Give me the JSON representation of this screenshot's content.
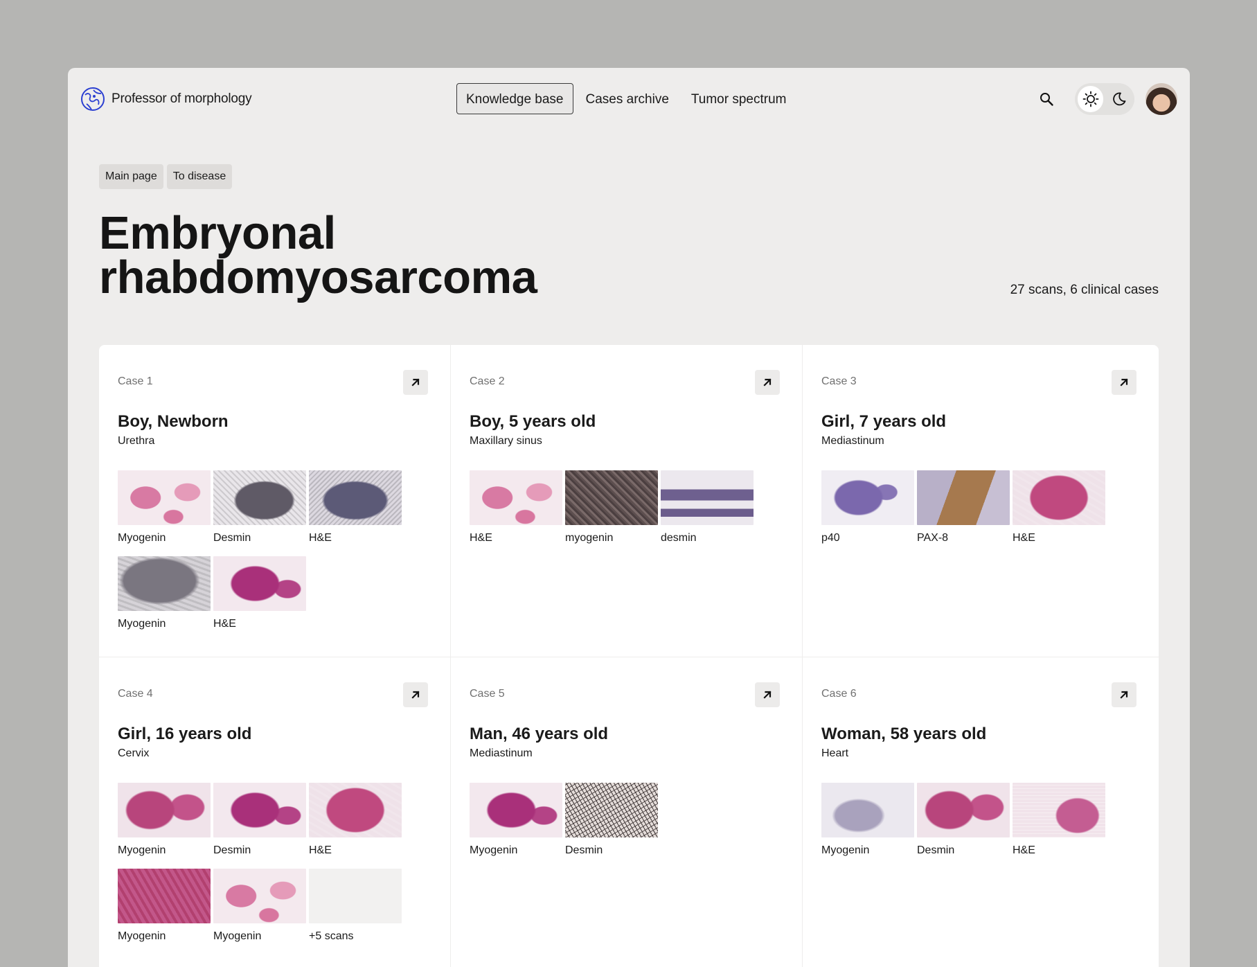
{
  "app": {
    "name": "Professor of morphology"
  },
  "nav": {
    "items": [
      "Knowledge base",
      "Cases archive",
      "Tumor spectrum"
    ],
    "active": 0
  },
  "icons": {
    "search": "search-icon",
    "light": "sun-icon",
    "dark": "moon-icon",
    "open": "arrow-up-right-icon"
  },
  "breadcrumb": [
    "Main page",
    "To disease"
  ],
  "page": {
    "title_line1": "Embryonal",
    "title_line2": "rhabdomyosarcoma",
    "summary": "27 scans, 6 clinical cases"
  },
  "cases": [
    {
      "label": "Case 1",
      "title": "Boy, Newborn",
      "site": "Urethra",
      "scans": [
        {
          "label": "Myogenin",
          "texture": "pink-light"
        },
        {
          "label": "Desmin",
          "texture": "gray-dark"
        },
        {
          "label": "H&E",
          "texture": "gray-blue"
        },
        {
          "label": "Myogenin",
          "texture": "gray-stone"
        },
        {
          "label": "H&E",
          "texture": "magenta"
        }
      ]
    },
    {
      "label": "Case 2",
      "title": "Boy, 5 years old",
      "site": "Maxillary sinus",
      "scans": [
        {
          "label": "H&E",
          "texture": "pink-light"
        },
        {
          "label": "myogenin",
          "texture": "brown-dark"
        },
        {
          "label": "desmin",
          "texture": "purple-strips"
        }
      ]
    },
    {
      "label": "Case 3",
      "title": "Girl, 7 years old",
      "site": "Mediastinum",
      "scans": [
        {
          "label": "p40",
          "texture": "violet"
        },
        {
          "label": "PAX-8",
          "texture": "brown-mix"
        },
        {
          "label": "H&E",
          "texture": "pink-dense"
        }
      ]
    },
    {
      "label": "Case 4",
      "title": "Girl, 16 years old",
      "site": "Cervix",
      "scans": [
        {
          "label": "Myogenin",
          "texture": "pink"
        },
        {
          "label": "Desmin",
          "texture": "magenta"
        },
        {
          "label": "H&E",
          "texture": "pink-dense"
        },
        {
          "label": "Myogenin",
          "texture": "pink-solid"
        },
        {
          "label": "Myogenin",
          "texture": "pink-light"
        },
        {
          "label": "+5 scans",
          "texture": "empty"
        }
      ]
    },
    {
      "label": "Case 5",
      "title": "Man, 46 years old",
      "site": "Mediastinum",
      "scans": [
        {
          "label": "Myogenin",
          "texture": "magenta"
        },
        {
          "label": "Desmin",
          "texture": "bw-mesh"
        }
      ]
    },
    {
      "label": "Case 6",
      "title": "Woman, 58 years old",
      "site": "Heart",
      "scans": [
        {
          "label": "Myogenin",
          "texture": "lav-light"
        },
        {
          "label": "Desmin",
          "texture": "pink"
        },
        {
          "label": "H&E",
          "texture": "pink-lace"
        }
      ]
    }
  ],
  "colors": {
    "page_bg": "#b5b5b3",
    "app_bg": "#eeedec",
    "card_bg": "#ffffff",
    "logo": "#2b3fd1"
  }
}
